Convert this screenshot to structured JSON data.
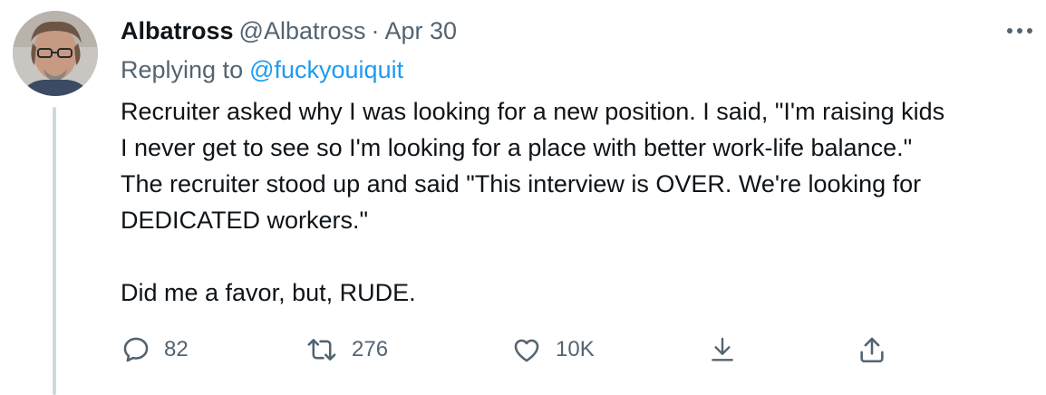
{
  "tweet": {
    "author": {
      "name": "Albatross",
      "handle": "@Albatross",
      "separator": "·",
      "date": "Apr 30",
      "avatar_icon": "user-avatar"
    },
    "reply_to": {
      "label": "Replying to",
      "mention": "@fuckyouiquit"
    },
    "body": {
      "lines": [
        "Recruiter asked why I was looking for a new position. I said, \"I'm raising kids",
        "I never get to see so I'm looking for a place with better work-life balance.\"",
        "The recruiter stood up and said \"This interview is OVER. We're looking for",
        "DEDICATED workers.\""
      ],
      "closing": "Did me a favor, but, RUDE."
    },
    "actions": {
      "reply_count": "82",
      "retweet_count": "276",
      "like_count": "10K"
    },
    "colors": {
      "text": "#0f1419",
      "secondary": "#536471",
      "link": "#1d9bf0",
      "thread_line": "#cfd9de"
    }
  }
}
